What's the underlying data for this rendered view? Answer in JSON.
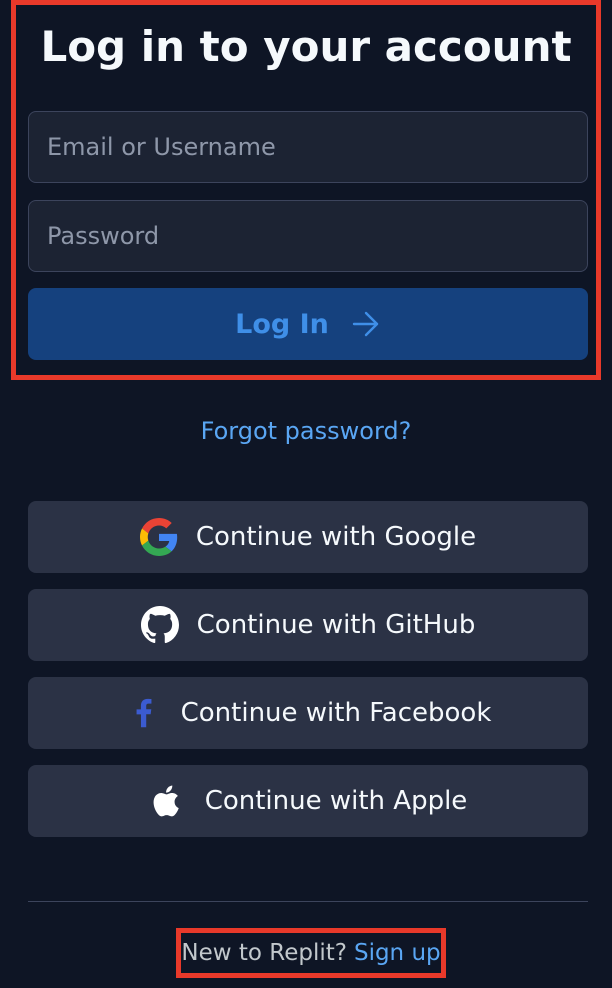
{
  "title": "Log in to your account",
  "form": {
    "email_placeholder": "Email or Username",
    "email_value": "",
    "password_placeholder": "Password",
    "password_value": "",
    "login_label": "Log In"
  },
  "forgot_password": "Forgot password?",
  "sso": [
    {
      "label": "Continue with Google",
      "icon": "google-icon"
    },
    {
      "label": "Continue with GitHub",
      "icon": "github-icon"
    },
    {
      "label": "Continue with Facebook",
      "icon": "facebook-icon"
    },
    {
      "label": "Continue with Apple",
      "icon": "apple-icon"
    }
  ],
  "signup": {
    "prompt": "New to Replit?",
    "link": "Sign up"
  },
  "colors": {
    "background": "#0e1525",
    "input_bg": "#1c2333",
    "primary_button": "#15417e",
    "primary_text": "#3f8fe8",
    "link": "#5aa6f3",
    "sso_button": "#2b3245",
    "highlight": "#e8392a"
  }
}
